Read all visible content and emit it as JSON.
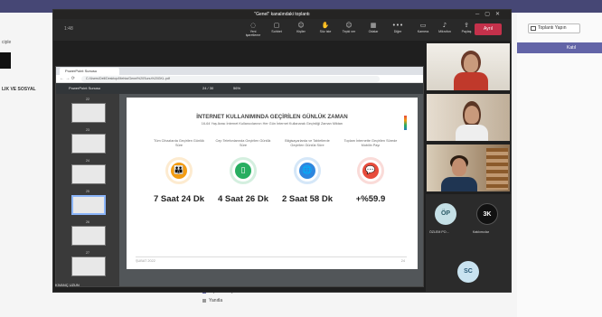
{
  "background": {
    "left_label_top": "ciple",
    "left_label_mid": "LIK VE SOSYAL",
    "join_button": "Toplantı Yapın",
    "end_button": "Katıl",
    "end_label": "toplantı",
    "bottom_items": [
      "Toplantı başlatıldı",
      "Yanıtla"
    ]
  },
  "meeting": {
    "title": "\"Genel\" kanalındaki toplantı",
    "timer": "1:48",
    "toolbar": [
      {
        "icon": "eye-off-icon",
        "glyph": "◌",
        "label": "Yeni işaretleme"
      },
      {
        "icon": "chat-icon",
        "glyph": "▢",
        "label": "Sohbet"
      },
      {
        "icon": "people-icon",
        "glyph": "☺",
        "label": "Kişiler"
      },
      {
        "icon": "hand-icon",
        "glyph": "✋",
        "label": "Söz iste"
      },
      {
        "icon": "react-icon",
        "glyph": "☺",
        "label": "Tepki ver"
      },
      {
        "icon": "rooms-icon",
        "glyph": "▦",
        "label": "Odalar"
      },
      {
        "icon": "more-icon",
        "glyph": "•••",
        "label": "Diğer"
      },
      {
        "icon": "camera-icon",
        "glyph": "▭",
        "label": "Kamera"
      },
      {
        "icon": "mic-icon",
        "glyph": "♪",
        "label": "Mikrofon"
      },
      {
        "icon": "share-icon",
        "glyph": "⇪",
        "label": "Paylaş"
      }
    ],
    "leave": "Ayrıl",
    "presenter": "KIVANÇ UZUN"
  },
  "browser": {
    "tab": "PowerPoint Sunusu",
    "url": "C:/Users/Dell/Desktop/Mehta/Genel%20Sunu%20GKL.pdf",
    "pdf_title": "PowerPoint Sunusu",
    "page_info": "24 / 30",
    "zoom": "56%",
    "thumb_numbers": [
      "22",
      "23",
      "24",
      "25",
      "26",
      "27"
    ]
  },
  "slide": {
    "title": "İNTERNET KULLANIMINDA GEÇİRİLEN GÜNLÜK ZAMAN",
    "subtitle": "16-64 Yaş Arası İnternet Kullanıcılarının Her Gün İnternet Kullanarak Geçirdiği Zaman Miktarı",
    "stats": [
      {
        "caption": "Tüm Cihazlarda Geçirilen Günlük Süre",
        "value": "7 Saat 24 Dk",
        "color": "#f39c12",
        "icon": "people-icon",
        "glyph": "👪"
      },
      {
        "caption": "Cep Telefonlarında Geçirilen Günlük Süre",
        "value": "4 Saat 26 Dk",
        "color": "#27ae60",
        "icon": "phone-icon",
        "glyph": "▯"
      },
      {
        "caption": "Bilgisayarlarda ve Tabletlerde Geçirilen Günlük Süre",
        "value": "2 Saat 58 Dk",
        "color": "#2e86de",
        "icon": "globe-icon",
        "glyph": "🌐"
      },
      {
        "caption": "Toplam İnternette Geçirilen Sürede Mobilin Payı",
        "value": "+%59.9",
        "color": "#e74c3c",
        "icon": "chat-bubbles-icon",
        "glyph": "💬"
      }
    ],
    "footer": "ŞUBAT 2022",
    "page": "24"
  },
  "participants": [
    {
      "initials": "ÖP",
      "name": "ÖZLEM PO..."
    },
    {
      "initials": "3K",
      "name": "Katılımcılar"
    },
    {
      "initials": "SC",
      "name": ""
    }
  ]
}
